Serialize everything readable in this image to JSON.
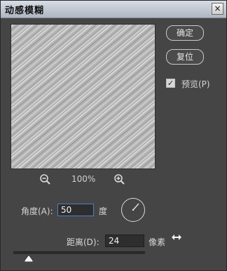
{
  "dialog": {
    "title": "动感模糊",
    "close_glyph": "×"
  },
  "buttons": {
    "ok": "确定",
    "reset": "复位"
  },
  "preview_toggle": {
    "label": "预览(P)",
    "checked": true,
    "check_glyph": "✓"
  },
  "zoom": {
    "value": "100%"
  },
  "angle": {
    "label": "角度(A):",
    "value": "50",
    "unit": "度"
  },
  "distance": {
    "label": "距离(D):",
    "value": "24",
    "unit": "像素"
  },
  "icons": {
    "zoom_out": "zoom-out-icon",
    "zoom_in": "zoom-in-icon",
    "angle_dial": "angle-dial-icon",
    "close": "close-icon"
  }
}
